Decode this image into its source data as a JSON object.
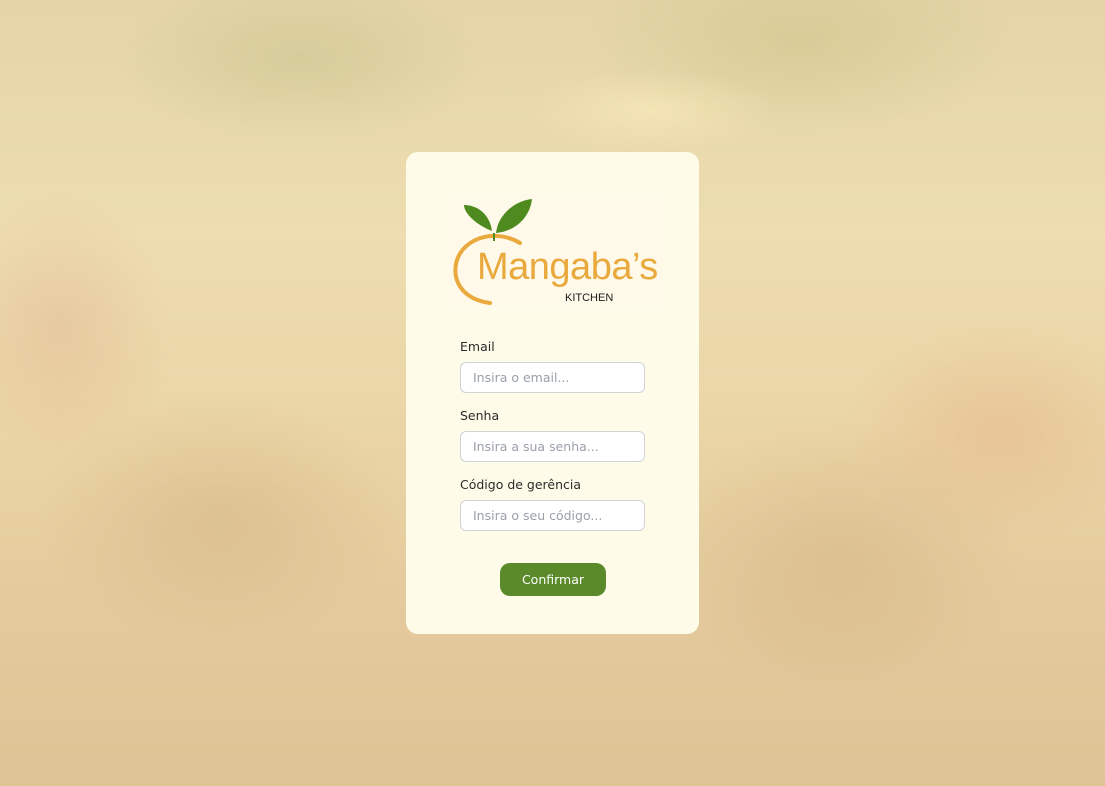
{
  "logo": {
    "name": "Mangaba’s",
    "subtitle": "KITCHEN",
    "colors": {
      "orange": "#e9a93c",
      "leaf": "#4f8a1e"
    }
  },
  "form": {
    "email": {
      "label": "Email",
      "placeholder": "Insira o email..."
    },
    "password": {
      "label": "Senha",
      "placeholder": "Insira a sua senha..."
    },
    "code": {
      "label": "Código de gerência",
      "placeholder": "Insira o seu código..."
    },
    "submit_label": "Confirmar"
  },
  "colors": {
    "card_bg": "#fefbe9",
    "button_bg": "#5a8a2a",
    "button_text": "#ffffff"
  }
}
